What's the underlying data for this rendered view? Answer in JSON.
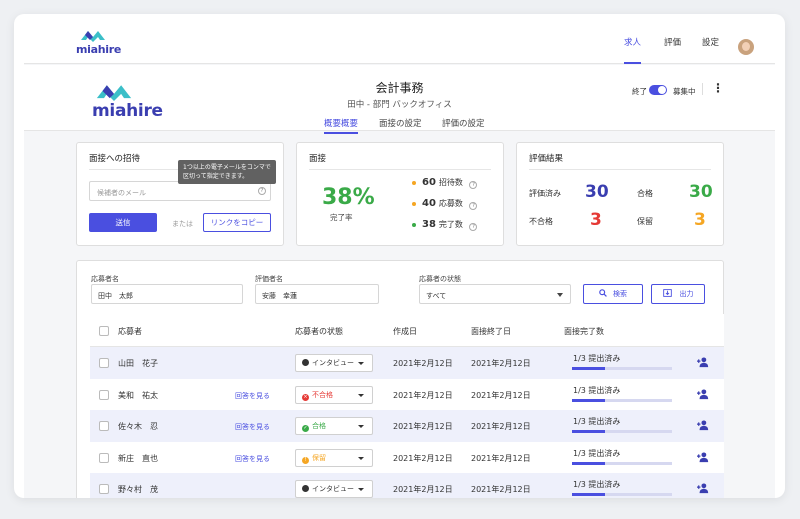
{
  "topbar": {
    "brand": "miahire",
    "nav": [
      {
        "label": "求人",
        "active": true
      },
      {
        "label": "評価",
        "active": false
      },
      {
        "label": "設定",
        "active": false
      }
    ]
  },
  "header": {
    "brand": "miahire",
    "title": "会計事務",
    "subtitle": "田中 - 部門 バックオフィス",
    "tabs": [
      {
        "label": "概要概要",
        "active": true
      },
      {
        "label": "面接の設定",
        "active": false
      },
      {
        "label": "評価の設定",
        "active": false
      }
    ],
    "toggle_off_label": "終了",
    "toggle_on_label": "募集中",
    "toggle_on": true
  },
  "invite": {
    "title": "面接への招待",
    "tooltip": "1つ以上の電子メールをコンマで区切って指定できます。",
    "email_placeholder": "候補者のメール",
    "send_label": "送信",
    "or_label": "または",
    "copy_link_label": "リンクをコピー"
  },
  "interview": {
    "title": "面接",
    "completion_pct": "38%",
    "completion_label": "完了率",
    "stats": [
      {
        "value": "60",
        "label": "招待数",
        "color": "#f5a623"
      },
      {
        "value": "40",
        "label": "応募数",
        "color": "#f5a623"
      },
      {
        "value": "38",
        "label": "完了数",
        "color": "#3aaa48"
      }
    ]
  },
  "evaluation": {
    "title": "評価結果",
    "items": [
      {
        "label": "評価済み",
        "value": "30",
        "color": "#3a3eb0"
      },
      {
        "label": "合格",
        "value": "30",
        "color": "#3aaa48"
      },
      {
        "label": "不合格",
        "value": "3",
        "color": "#e53935"
      },
      {
        "label": "保留",
        "value": "3",
        "color": "#f5a623"
      }
    ]
  },
  "filters": {
    "applicant_label": "応募者名",
    "applicant_value": "田中　太郎",
    "evaluator_label": "評価者名",
    "evaluator_value": "安藤　幸蓮",
    "status_label": "応募者の状態",
    "status_value": "すべて",
    "search_label": "検索",
    "export_label": "出力"
  },
  "table": {
    "headers": [
      "応募者",
      "応募者の状態",
      "作成日",
      "面接終了日",
      "面接完了数"
    ],
    "rows": [
      {
        "name": "山田　花子",
        "link": "",
        "status": "インタビュー",
        "status_color": "#333333",
        "created": "2021年2月12日",
        "ended": "2021年2月12日",
        "progress": "1/3 提出済み",
        "progress_fraction": 0.333
      },
      {
        "name": "美和　祐太",
        "link": "回答を見る",
        "status": "不合格",
        "status_color": "#e53935",
        "created": "2021年2月12日",
        "ended": "2021年2月12日",
        "progress": "1/3 提出済み",
        "progress_fraction": 0.333
      },
      {
        "name": "佐々木　忍",
        "link": "回答を見る",
        "status": "合格",
        "status_color": "#3aaa48",
        "created": "2021年2月12日",
        "ended": "2021年2月12日",
        "progress": "1/3 提出済み",
        "progress_fraction": 0.333
      },
      {
        "name": "新庄　直也",
        "link": "回答を見る",
        "status": "保留",
        "status_color": "#f5a623",
        "created": "2021年2月12日",
        "ended": "2021年2月12日",
        "progress": "1/3 提出済み",
        "progress_fraction": 0.333
      },
      {
        "name": "野々村　茂",
        "link": "",
        "status": "インタビュー",
        "status_color": "#333333",
        "created": "2021年2月12日",
        "ended": "2021年2月12日",
        "progress": "1/3 提出済み",
        "progress_fraction": 0.333
      }
    ]
  }
}
